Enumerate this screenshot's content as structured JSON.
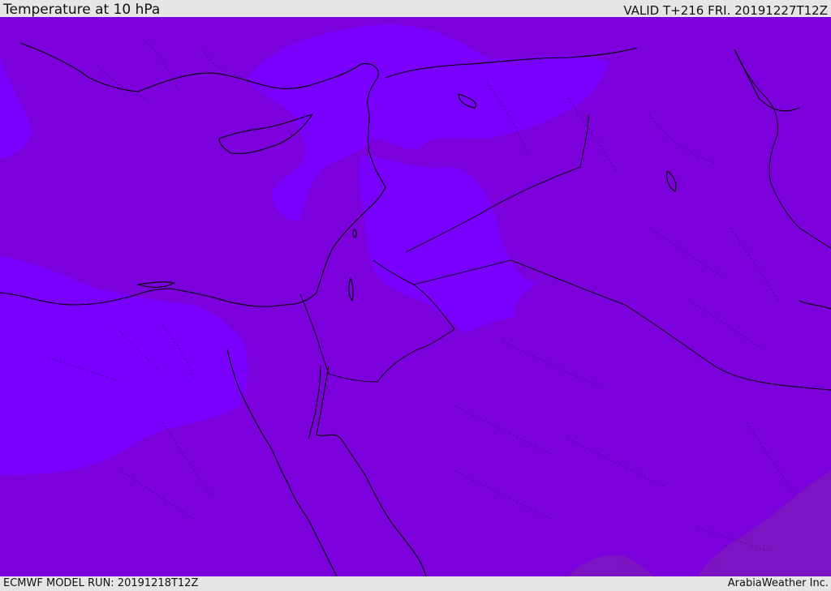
{
  "header": {
    "title": "Temperature at 10 hPa",
    "valid": "VALID T+216 FRI. 20191227T12Z"
  },
  "footer": {
    "model_run": "ECMWF MODEL RUN: 20191218T12Z",
    "brand": "ArabiaWeather Inc."
  },
  "colors": {
    "background_field": "#7b00dc",
    "cold_band": "#7a00ff",
    "warm_band": "#7d16c0",
    "coastline": "#000000",
    "borders": "#1a0a3a"
  }
}
